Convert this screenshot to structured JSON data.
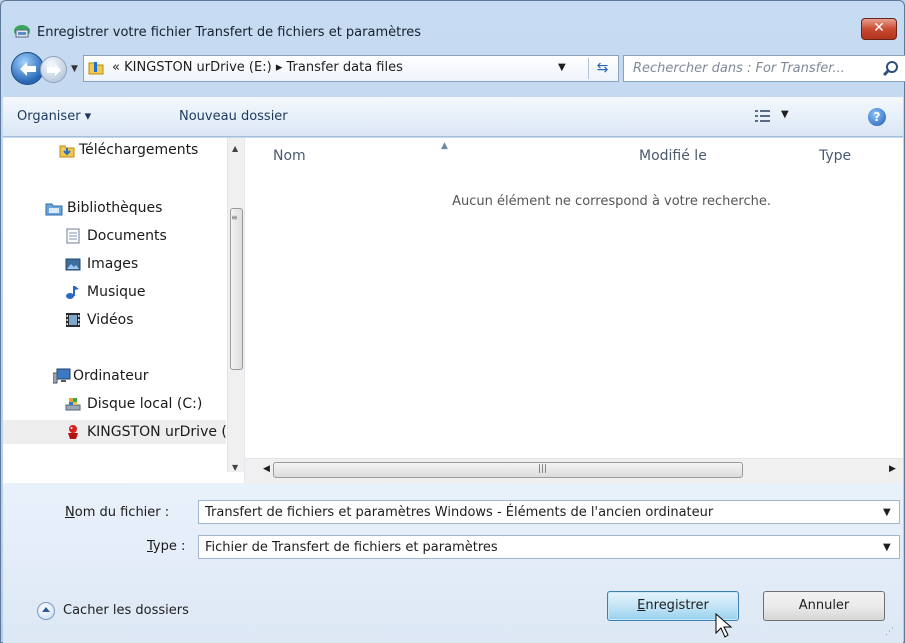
{
  "window": {
    "title": "Enregistrer votre fichier Transfert de fichiers et paramètres",
    "close_label": "✕"
  },
  "nav": {
    "address_prefix": "«",
    "breadcrumb": [
      "KINGSTON urDrive (E:)",
      "Transfer data files"
    ],
    "separator": "▸",
    "search_placeholder": "Rechercher dans : For Transfer..."
  },
  "toolbar": {
    "organize_label": "Organiser ▾",
    "new_folder_label": "Nouveau dossier"
  },
  "tree": {
    "items": [
      {
        "label": "Téléchargements",
        "icon": "downloads-folder-icon"
      },
      {
        "label": "Bibliothèques",
        "icon": "libraries-icon"
      },
      {
        "label": "Documents",
        "icon": "documents-icon"
      },
      {
        "label": "Images",
        "icon": "images-icon"
      },
      {
        "label": "Musique",
        "icon": "music-icon"
      },
      {
        "label": "Vidéos",
        "icon": "videos-icon"
      },
      {
        "label": "Ordinateur",
        "icon": "computer-icon"
      },
      {
        "label": "Disque local (C:)",
        "icon": "local-disk-icon"
      },
      {
        "label": "KINGSTON urDrive (E:)",
        "icon": "kingston-drive-icon",
        "selected": true
      }
    ]
  },
  "file_list": {
    "columns": [
      "Nom",
      "Modifié le",
      "Type"
    ],
    "empty_message": "Aucun élément ne correspond à votre recherche."
  },
  "form": {
    "filename_label": "Nom du fichier :",
    "filename_value": "Transfert de fichiers et paramètres Windows - Éléments de l'ancien ordinateur",
    "type_label": "Type :",
    "type_value": "Fichier de Transfert de fichiers et paramètres"
  },
  "footer": {
    "hide_folders_label": "Cacher les dossiers",
    "save_label": "Enregistrer",
    "cancel_label": "Annuler"
  }
}
